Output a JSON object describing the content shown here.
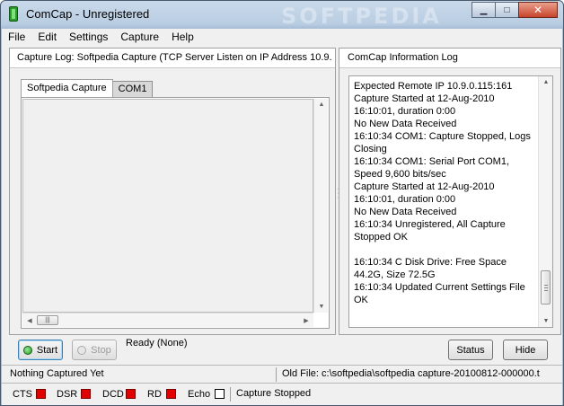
{
  "window": {
    "title": "ComCap - Unregistered",
    "watermark": "SOFTPEDIA"
  },
  "window_controls": {
    "minimize": "▁",
    "maximize": "□",
    "close": "✕"
  },
  "menu": [
    "File",
    "Edit",
    "Settings",
    "Capture",
    "Help"
  ],
  "left_panel": {
    "header": "Capture Log: Softpedia Capture (TCP Server Listen on IP Address 10.9.",
    "tabs": [
      "Softpedia Capture",
      "COM1"
    ]
  },
  "right_panel": {
    "header": "ComCap Information Log",
    "log_lines": [
      "Expected Remote IP 10.9.0.115:161",
      "Capture Started at 12-Aug-2010",
      "16:10:01, duration 0:00",
      "No New Data Received",
      "16:10:34 COM1: Capture Stopped, Logs",
      "Closing",
      "16:10:34 COM1: Serial Port COM1,",
      "Speed 9,600 bits/sec",
      "Capture Started at 12-Aug-2010",
      "16:10:01, duration 0:00",
      "No New Data Received",
      "16:10:34 Unregistered, All Capture",
      "Stopped OK",
      "",
      "16:10:34 C Disk Drive: Free Space",
      "44.2G, Size 72.5G",
      "16:10:34 Updated Current Settings File",
      "OK"
    ]
  },
  "controls": {
    "start": "Start",
    "stop": "Stop",
    "ready": "Ready (None)",
    "status": "Status",
    "hide": "Hide"
  },
  "status_bar": {
    "left": "Nothing Captured Yet",
    "right": "Old File: c:\\softpedia\\softpedia capture-20100812-000000.t"
  },
  "signals": {
    "cts": "CTS",
    "dsr": "DSR",
    "dcd": "DCD",
    "rd": "RD",
    "echo": "Echo",
    "capture_state": "Capture Stopped"
  },
  "colors": {
    "signal_on": "#e00000",
    "title_gradient": "#b9cde2"
  }
}
